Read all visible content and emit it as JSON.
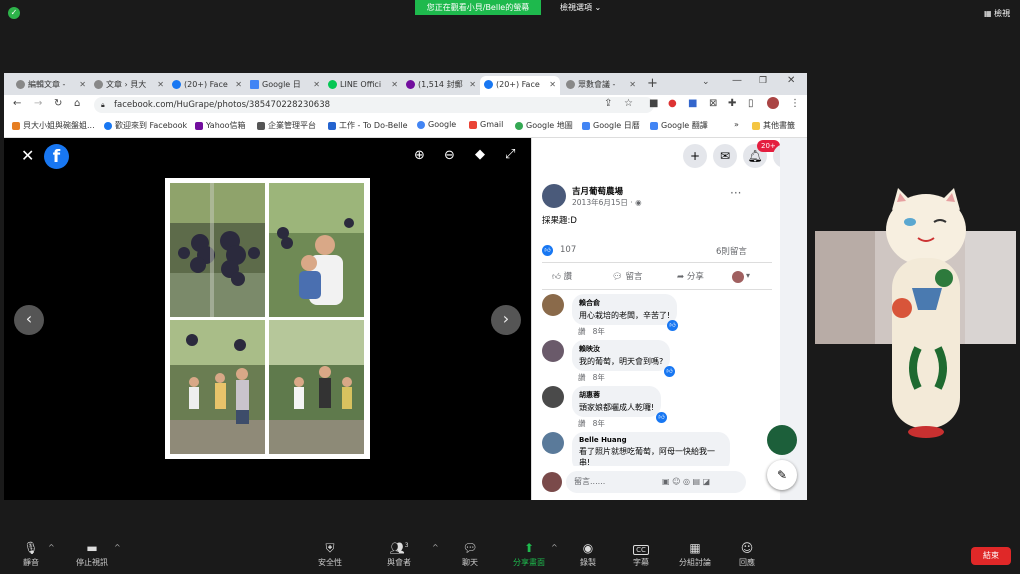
{
  "zoom": {
    "banner": "您正在觀看小貝/Belle的螢幕",
    "view_options": "檢視選項 ⌄",
    "view_top_right": "檢視",
    "end": "結束",
    "toolbar": [
      {
        "label": "靜音",
        "icon": "microphone-icon"
      },
      {
        "label": "停止視訊",
        "icon": "video-camera-icon"
      },
      {
        "label": "安全性",
        "icon": "shield-icon"
      },
      {
        "label": "與會者",
        "icon": "participants-icon",
        "count": "3"
      },
      {
        "label": "聊天",
        "icon": "chat-icon"
      },
      {
        "label": "分享畫面",
        "icon": "share-screen-icon"
      },
      {
        "label": "錄製",
        "icon": "record-icon"
      },
      {
        "label": "字幕",
        "icon": "cc-icon",
        "badge": "CC"
      },
      {
        "label": "分組討論",
        "icon": "breakout-icon"
      },
      {
        "label": "回應",
        "icon": "reaction-icon"
      }
    ]
  },
  "browser": {
    "tabs": [
      "編輯文章 -",
      "文章 › 貝大",
      "(20+) Face",
      "Google 日",
      "LINE Offici",
      "(1,514 封郵",
      "(20+) Face",
      "眾數會議 -"
    ],
    "active_tab": 6,
    "url": "facebook.com/HuGrape/photos/385470228230638",
    "bookmarks": [
      "貝大小姐與碗盤姐...",
      "歡迎來到 Facebook",
      "Yahoo信箱",
      "企業管理平台",
      "工作 - To Do-Belle",
      "Google",
      "Gmail",
      "Google 地圖",
      "Google 日曆",
      "Google 翻譯"
    ],
    "bookmarks_more": "»",
    "other_bookmarks": "其他書籤"
  },
  "post": {
    "page_name": "吉月葡萄農場",
    "date": "2013年6月15日 · ",
    "text": "採果趣:D",
    "like_count": "107",
    "comment_count": "6則留言",
    "actions": [
      "讚",
      "留言",
      "分享"
    ],
    "notification_badge": "20+",
    "comments": [
      {
        "name": "賴合俞",
        "text": "用心栽培的老闆，辛苦了!",
        "like": "讚",
        "time": "8年"
      },
      {
        "name": "賴映汝",
        "text": "我的葡萄，明天會到嗎?",
        "like": "讚",
        "time": "8年"
      },
      {
        "name": "胡惠蓉",
        "text": "頭家娘都曬成人乾囉!",
        "like": "讚",
        "time": "8年"
      },
      {
        "name": "Belle Huang",
        "text": "看了照片就想吃葡萄，阿母一快給我一串!"
      }
    ],
    "comment_placeholder": "留言......"
  },
  "colors": {
    "zoom_green": "#1eb94d",
    "fb_blue": "#1877f2",
    "end_red": "#e02828"
  }
}
